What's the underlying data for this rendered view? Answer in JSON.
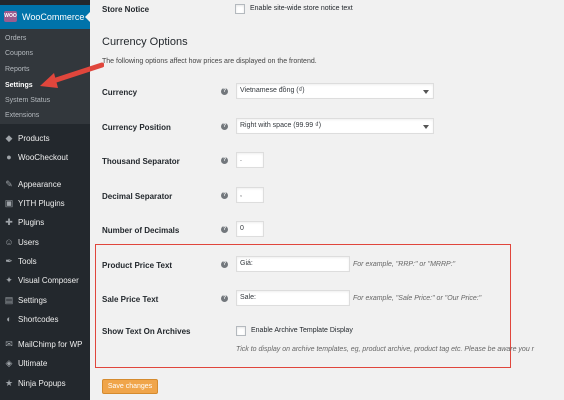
{
  "sidebar": {
    "woocommerce": {
      "logo": "WOO",
      "label": "WooCommerce"
    },
    "submenu": [
      "Orders",
      "Coupons",
      "Reports",
      "Settings",
      "System Status",
      "Extensions"
    ],
    "items": [
      {
        "icon": "products-icon",
        "glyph": "◆",
        "label": "Products"
      },
      {
        "icon": "woocheckout-icon",
        "glyph": "●",
        "label": "WooCheckout"
      },
      {
        "icon": "appearance-icon",
        "glyph": "✎",
        "label": "Appearance"
      },
      {
        "icon": "yith-icon",
        "glyph": "▣",
        "label": "YITH Plugins"
      },
      {
        "icon": "plugins-icon",
        "glyph": "✚",
        "label": "Plugins"
      },
      {
        "icon": "users-icon",
        "glyph": "☺",
        "label": "Users"
      },
      {
        "icon": "tools-icon",
        "glyph": "✒",
        "label": "Tools"
      },
      {
        "icon": "visual-composer-icon",
        "glyph": "✦",
        "label": "Visual Composer"
      },
      {
        "icon": "settings-icon",
        "glyph": "▤",
        "label": "Settings"
      },
      {
        "icon": "shortcodes-icon",
        "glyph": "◐",
        "label": "Shortcodes"
      },
      {
        "icon": "mailchimp-icon",
        "glyph": "✉",
        "label": "MailChimp for WP"
      },
      {
        "icon": "ultimate-icon",
        "glyph": "◈",
        "label": "Ultimate"
      },
      {
        "icon": "ninja-popups-icon",
        "glyph": "★",
        "label": "Ninja Popups"
      }
    ]
  },
  "main": {
    "store_notice": {
      "label": "Store Notice",
      "checkbox_label": "Enable site-wide store notice text"
    },
    "currency_options": {
      "title": "Currency Options",
      "description": "The following options affect how prices are displayed on the frontend."
    },
    "fields": {
      "currency": {
        "label": "Currency",
        "value": "Vietnamese đồng (₫)"
      },
      "currency_position": {
        "label": "Currency Position",
        "value": "Right with space (99.99 ₫)"
      },
      "thousand_separator": {
        "label": "Thousand Separator",
        "value": "."
      },
      "decimal_separator": {
        "label": "Decimal Separator",
        "value": ","
      },
      "number_of_decimals": {
        "label": "Number of Decimals",
        "value": "0"
      },
      "product_price_text": {
        "label": "Product Price Text",
        "value": "Giá:",
        "hint": "For example, \"RRP:\" or \"MRRP:\""
      },
      "sale_price_text": {
        "label": "Sale Price Text",
        "value": "Sale:",
        "hint": "For example, \"Sale Price:\" or \"Our Price:\""
      },
      "show_text_on_archives": {
        "label": "Show Text On Archives",
        "checkbox_label": "Enable Archive Template Display",
        "hint": "Tick to display on archive templates, eg, product archive, product tag etc. Please be aware you r"
      }
    },
    "save_button": "Save changes"
  },
  "colors": {
    "highlight": "#e0463c",
    "arrow": "#e0463c",
    "accent": "#0073aa",
    "save": "#f0a54a"
  }
}
